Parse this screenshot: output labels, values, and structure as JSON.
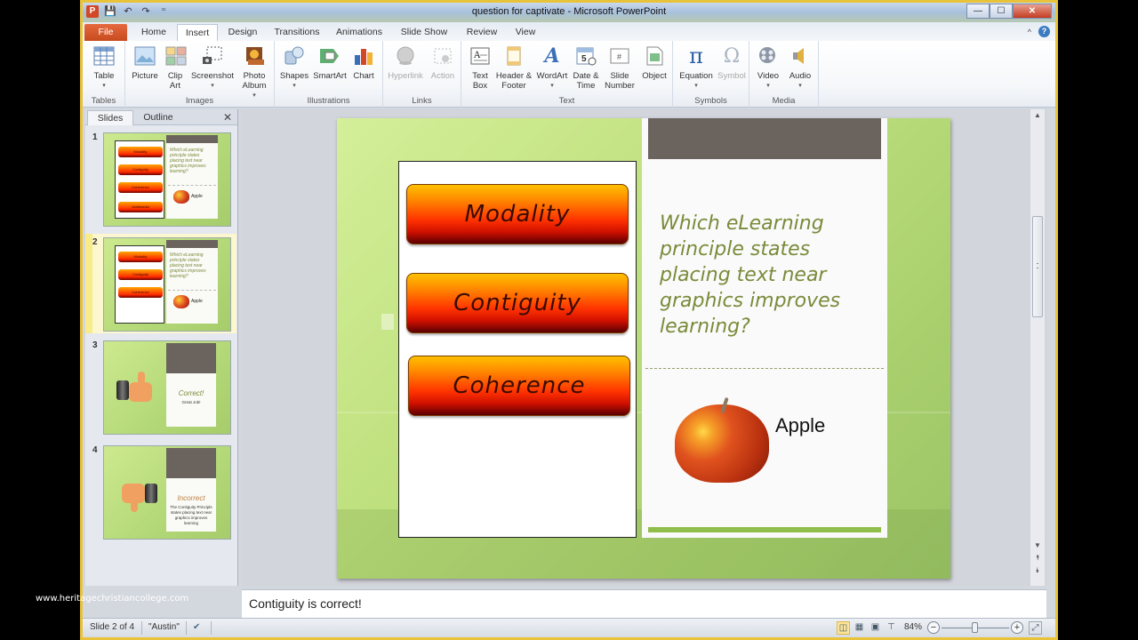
{
  "watermark": "www.heritagechristiancollege.com",
  "window": {
    "title": "question for captivate  -  Microsoft PowerPoint",
    "controls": {
      "minimize": "—",
      "maximize": "☐",
      "close": "✕"
    }
  },
  "quick_access": {
    "app_icon": "P",
    "save": "💾",
    "undo": "↶",
    "redo": "↷",
    "customize": "⁼"
  },
  "tabs": [
    {
      "label": "File"
    },
    {
      "label": "Home"
    },
    {
      "label": "Insert",
      "active": true
    },
    {
      "label": "Design"
    },
    {
      "label": "Transitions"
    },
    {
      "label": "Animations"
    },
    {
      "label": "Slide Show"
    },
    {
      "label": "Review"
    },
    {
      "label": "View"
    }
  ],
  "ribbon_right": {
    "minimize_ribbon": "^",
    "help": "?"
  },
  "ribbon": {
    "groups": [
      {
        "label": "Tables",
        "buttons": [
          {
            "label": "Table",
            "arrow": "▾",
            "icon": "table-icon"
          }
        ]
      },
      {
        "label": "Images",
        "buttons": [
          {
            "label": "Picture",
            "icon": "picture-icon"
          },
          {
            "label": "Clip Art",
            "icon": "clip-art-icon"
          },
          {
            "label": "Screenshot",
            "arrow": "▾",
            "icon": "screenshot-icon"
          },
          {
            "label": "Photo Album",
            "arrow": "▾",
            "icon": "photo-album-icon"
          }
        ]
      },
      {
        "label": "Illustrations",
        "buttons": [
          {
            "label": "Shapes",
            "arrow": "▾",
            "icon": "shapes-icon"
          },
          {
            "label": "SmartArt",
            "icon": "smartart-icon"
          },
          {
            "label": "Chart",
            "icon": "chart-icon"
          }
        ]
      },
      {
        "label": "Links",
        "buttons": [
          {
            "label": "Hyperlink",
            "icon": "hyperlink-icon",
            "disabled": true
          },
          {
            "label": "Action",
            "icon": "action-icon",
            "disabled": true
          }
        ]
      },
      {
        "label": "Text",
        "buttons": [
          {
            "label": "Text Box",
            "icon": "text-box-icon"
          },
          {
            "label": "Header & Footer",
            "icon": "header-footer-icon"
          },
          {
            "label": "WordArt",
            "arrow": "▾",
            "icon": "wordart-icon"
          },
          {
            "label": "Date & Time",
            "icon": "date-time-icon"
          },
          {
            "label": "Slide Number",
            "icon": "slide-number-icon"
          },
          {
            "label": "Object",
            "icon": "object-icon"
          }
        ]
      },
      {
        "label": "Symbols",
        "buttons": [
          {
            "label": "Equation",
            "arrow": "▾",
            "icon": "equation-icon"
          },
          {
            "label": "Symbol",
            "icon": "symbol-icon",
            "disabled": true
          }
        ]
      },
      {
        "label": "Media",
        "buttons": [
          {
            "label": "Video",
            "arrow": "▾",
            "icon": "video-icon"
          },
          {
            "label": "Audio",
            "arrow": "▾",
            "icon": "audio-icon"
          }
        ]
      }
    ]
  },
  "slides_pane": {
    "tabs": [
      {
        "label": "Slides",
        "active": true
      },
      {
        "label": "Outline"
      }
    ],
    "close": "✕",
    "thumbnails": [
      {
        "number": "1",
        "buttons": [
          "Modality",
          "Contiguity",
          "Coherence",
          "Multimedia"
        ],
        "question": "Which eLearning principle states placing text near graphics improves learning?",
        "image_label": "Apple"
      },
      {
        "number": "2",
        "selected": true,
        "buttons": [
          "Modality",
          "Contiguity",
          "Coherence"
        ],
        "question": "Which eLearning principle states placing text near graphics improves learning?",
        "image_label": "Apple"
      },
      {
        "number": "3",
        "heading": "Correct!",
        "sub": "Great Job!",
        "hand": "thumbs-up"
      },
      {
        "number": "4",
        "heading": "Incorrect",
        "sub": "The Contiguity Principle states placing text near graphics improves learning",
        "hand": "thumbs-down"
      }
    ]
  },
  "slide": {
    "answers": [
      "Modality",
      "Contiguity",
      "Coherence"
    ],
    "question": "Which eLearning principle states placing text near graphics improves learning?",
    "image_label": "Apple"
  },
  "notes": {
    "text": "Contiguity is correct!"
  },
  "scrollbar": {
    "up": "▲",
    "down": "▼",
    "prev_slide": "⯭",
    "next_slide": "⯯"
  },
  "status_bar": {
    "slide_info": "Slide 2 of 4",
    "theme": "\"Austin\"",
    "spellcheck_icon": "✔",
    "views": [
      {
        "name": "normal",
        "glyph": "◫",
        "active": true
      },
      {
        "name": "slide-sorter",
        "glyph": "▦"
      },
      {
        "name": "reading",
        "glyph": "▣"
      },
      {
        "name": "slideshow",
        "glyph": "⊤"
      }
    ],
    "zoom_level": "84%",
    "zoom_fraction": 0.5,
    "zoom_minus": "−",
    "zoom_plus": "+",
    "fit_icon": "⤢"
  }
}
